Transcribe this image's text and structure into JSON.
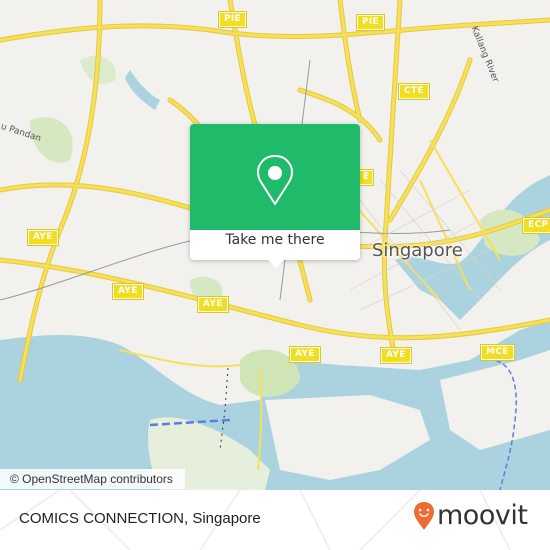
{
  "map": {
    "city_label": "Singapore",
    "area_labels": [
      "u Pandan",
      "Kallang River"
    ],
    "highway_shields": [
      {
        "label": "PIE"
      },
      {
        "label": "PIE"
      },
      {
        "label": "CTE"
      },
      {
        "label": "AYE"
      },
      {
        "label": "AYE"
      },
      {
        "label": "AYE"
      },
      {
        "label": "AYE"
      },
      {
        "label": "AYE"
      },
      {
        "label": "MCE"
      },
      {
        "label": "ECP"
      },
      {
        "label": "E"
      }
    ],
    "colors": {
      "land": "#f2f1ed",
      "water": "#aad3df",
      "park": "#cfe5b8",
      "road": "#f6e05a",
      "road_casing": "#e5c93a",
      "popup_green": "#1fba6a"
    }
  },
  "popup": {
    "icon": "location-pin-icon",
    "button_label": "Take me there"
  },
  "attribution": {
    "text": "© OpenStreetMap contributors"
  },
  "footer": {
    "place_name": "COMICS CONNECTION, Singapore",
    "brand": {
      "name": "moovit",
      "icon": "moovit-pin-logo-icon",
      "color": "#f06a35"
    }
  }
}
